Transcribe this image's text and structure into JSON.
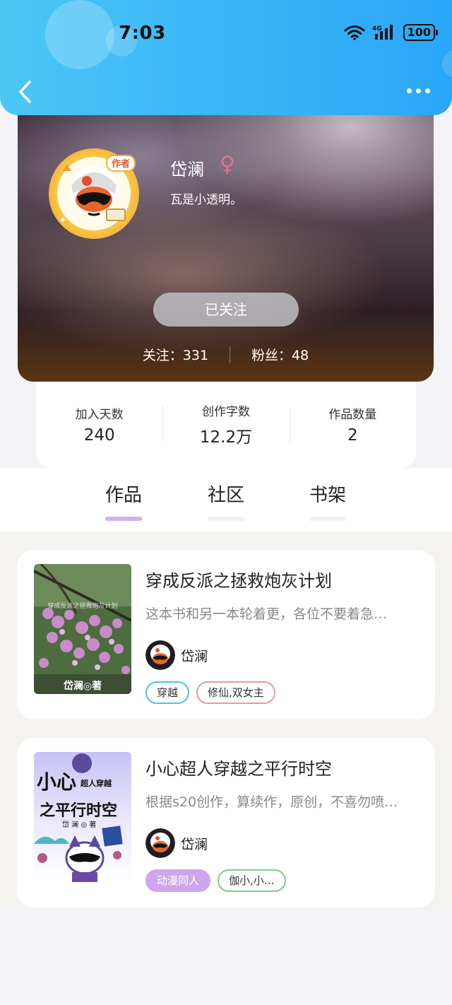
{
  "status_bar": {
    "time": "7:03",
    "network": "4G",
    "battery": "100"
  },
  "profile": {
    "nickname": "岱澜",
    "gender_symbol": "♀",
    "bio": "瓦是小透明。",
    "follow_button": "已关注",
    "following": "关注：331",
    "fans": "粉丝：48",
    "badge": "作者"
  },
  "stats": [
    {
      "label": "加入天数",
      "value": "240"
    },
    {
      "label": "创作字数",
      "value": "12.2万"
    },
    {
      "label": "作品数量",
      "value": "2"
    }
  ],
  "tabs": [
    {
      "label": "作品",
      "active": true
    },
    {
      "label": "社区",
      "active": false
    },
    {
      "label": "书架",
      "active": false
    }
  ],
  "books": [
    {
      "title": "穿成反派之拯救炮灰计划",
      "description": "这本书和另一本轮着更，各位不要着急…",
      "author": "岱澜",
      "cover_text": "岱澜◎著",
      "cover_subtitle": "穿成反派之拯救炮灰计划",
      "tags": [
        "穿越",
        "修仙,双女主"
      ]
    },
    {
      "title": "小心超人穿越之平行时空",
      "description": "根据s20创作，算续作，原创，不喜勿喷…",
      "author": "岱澜",
      "cover_line1": "小心",
      "cover_line1b": "超人穿越",
      "cover_line2": "之平行时空",
      "cover_credit": "岱 澜 ◎ 著",
      "tags": [
        "动漫同人",
        "伽小,小…"
      ]
    }
  ],
  "colors": {
    "header_start": "#4cc7f5",
    "header_end": "#2aa6f7",
    "tab_indicator": "#cdb2ee",
    "tag_cyan": "#4fc3de",
    "tag_pink": "#e59a9a",
    "tag_purple": "#cfa6ee",
    "tag_green": "#7ec98a"
  },
  "icons": [
    "back-arrow-icon",
    "more-icon",
    "wifi-icon",
    "signal-icon",
    "battery-icon",
    "female-icon"
  ]
}
